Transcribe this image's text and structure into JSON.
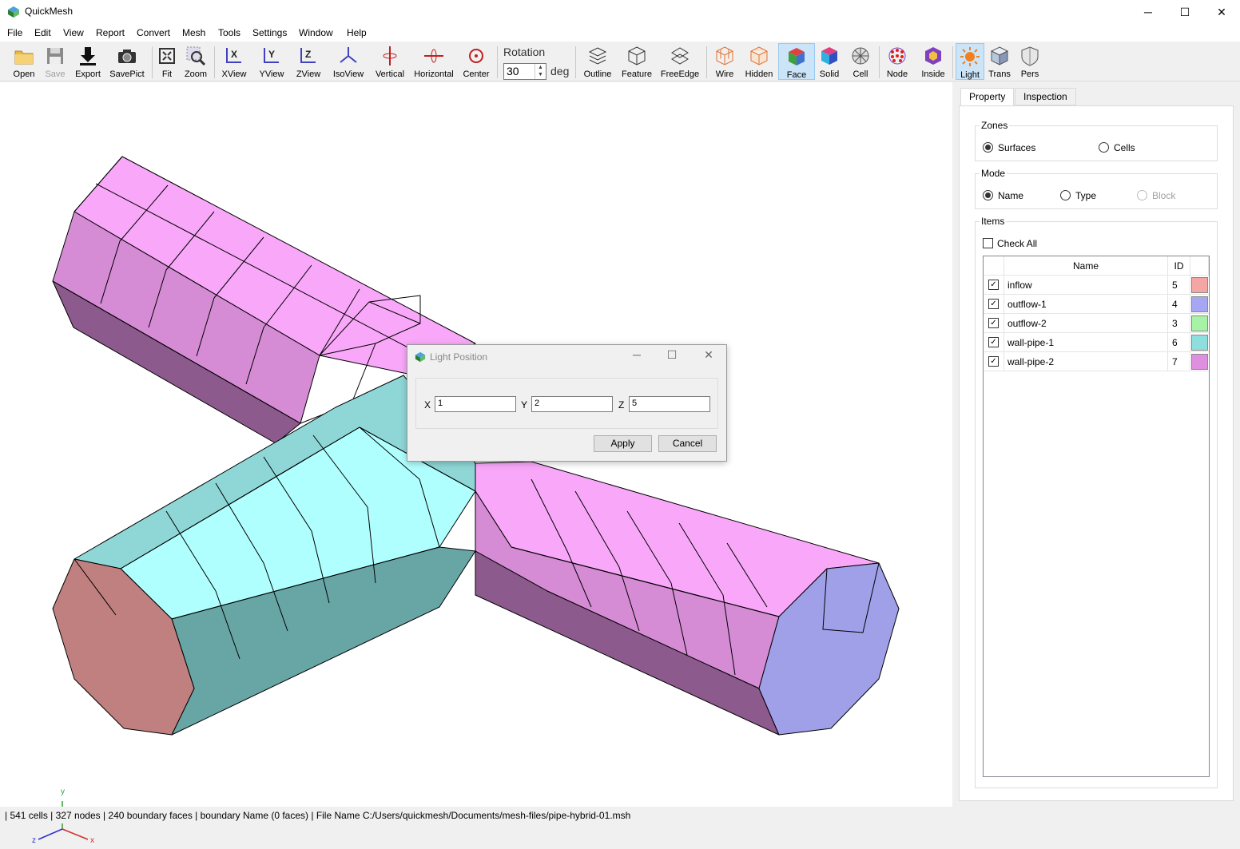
{
  "window": {
    "title": "QuickMesh",
    "minimize": "─",
    "maximize": "☐",
    "close": "✕"
  },
  "menu": [
    "File",
    "Edit",
    "View",
    "Report",
    "Convert",
    "Mesh",
    "Tools",
    "Settings",
    "Window",
    "Help"
  ],
  "toolbar": {
    "open": "Open",
    "save": "Save",
    "export": "Export",
    "savepict": "SavePict",
    "fit": "Fit",
    "zoom": "Zoom",
    "xview": "XView",
    "yview": "YView",
    "zview": "ZView",
    "isoview": "IsoView",
    "vertical": "Vertical",
    "horizontal": "Horizontal",
    "center": "Center",
    "rotation_label": "Rotation",
    "rotation_value": "30",
    "rotation_unit": "deg",
    "outline": "Outline",
    "feature": "Feature",
    "freeedge": "FreeEdge",
    "wire": "Wire",
    "hidden": "Hidden",
    "face": "Face",
    "solid": "Solid",
    "cell": "Cell",
    "node": "Node",
    "inside": "Inside",
    "light": "Light",
    "trans": "Trans",
    "pers": "Pers",
    "active": [
      "Face",
      "Light"
    ]
  },
  "axes": {
    "y": "y",
    "z": "z",
    "x": "x"
  },
  "panel": {
    "tabs": [
      "Property",
      "Inspection"
    ],
    "active_tab": "Property",
    "zones": {
      "title": "Zones",
      "options": [
        "Surfaces",
        "Cells"
      ],
      "selected": "Surfaces"
    },
    "mode": {
      "title": "Mode",
      "options": [
        "Name",
        "Type",
        "Block"
      ],
      "selected": "Name",
      "disabled": [
        "Block"
      ]
    },
    "items": {
      "title": "Items",
      "check_all": "Check All",
      "columns": [
        "Name",
        "ID"
      ],
      "rows": [
        {
          "name": "inflow",
          "id": "5",
          "color": "#f4a6a6",
          "checked": true
        },
        {
          "name": "outflow-1",
          "id": "4",
          "color": "#a6a6f2",
          "checked": true
        },
        {
          "name": "outflow-2",
          "id": "3",
          "color": "#a6f2a6",
          "checked": true
        },
        {
          "name": "wall-pipe-1",
          "id": "6",
          "color": "#8fdede",
          "checked": true
        },
        {
          "name": "wall-pipe-2",
          "id": "7",
          "color": "#de8fde",
          "checked": true
        }
      ]
    }
  },
  "dialog": {
    "title": "Light Position",
    "x_label": "X",
    "x_value": "1",
    "y_label": "Y",
    "y_value": "2",
    "z_label": "Z",
    "z_value": "5",
    "apply": "Apply",
    "cancel": "Cancel"
  },
  "status": "| 541 cells | 327 nodes | 240 boundary faces |  boundary Name  (0 faces) | File Name C:/Users/quickmesh/Documents/mesh-files/pipe-hybrid-01.msh",
  "colors": {
    "wall_pipe_2_light": "#f9a8f9",
    "wall_pipe_2_mid": "#d58cd5",
    "wall_pipe_2_dark": "#8c5a8c",
    "wall_pipe_1_light": "#b0ffff",
    "wall_pipe_1_mid": "#8fd7d7",
    "wall_pipe_1_dark": "#68a6a6",
    "inflow": "#c08080",
    "outflow_1": "#a0a0e8"
  }
}
